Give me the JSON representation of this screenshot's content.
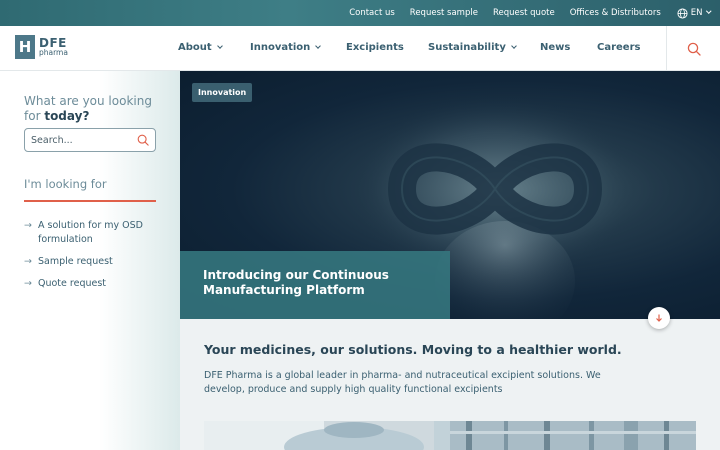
{
  "topbar": {
    "links": [
      "Contact us",
      "Request sample",
      "Request quote",
      "Offices & Distributors"
    ],
    "language": "EN"
  },
  "logo": {
    "mark": "H",
    "line1": "DFE",
    "line2": "pharma"
  },
  "nav": {
    "items": [
      {
        "label": "About",
        "dropdown": true
      },
      {
        "label": "Innovation",
        "dropdown": true
      },
      {
        "label": "Excipients",
        "dropdown": false
      },
      {
        "label": "Sustainability",
        "dropdown": true
      },
      {
        "label": "News",
        "dropdown": false
      },
      {
        "label": "Careers",
        "dropdown": false
      }
    ],
    "search_icon": "search-icon"
  },
  "sidebar": {
    "question_prefix": "What are you looking for",
    "question_bold": "today?",
    "search_placeholder": "Search...",
    "looking_for": "I'm looking for",
    "links": [
      "A solution for my OSD formulation",
      "Sample request",
      "Quote request"
    ]
  },
  "hero": {
    "tag": "Innovation",
    "title": "Introducing our Continuous Manufacturing Platform"
  },
  "content": {
    "headline": "Your medicines, our solutions. Moving to a healthier world.",
    "body": "DFE Pharma is a global leader in pharma- and nutraceutical excipient solutions. We develop, produce and supply high quality functional excipients"
  },
  "colors": {
    "brand_teal": "#3e7e86",
    "text_dark": "#2a4656",
    "accent_red": "#e0604a"
  }
}
